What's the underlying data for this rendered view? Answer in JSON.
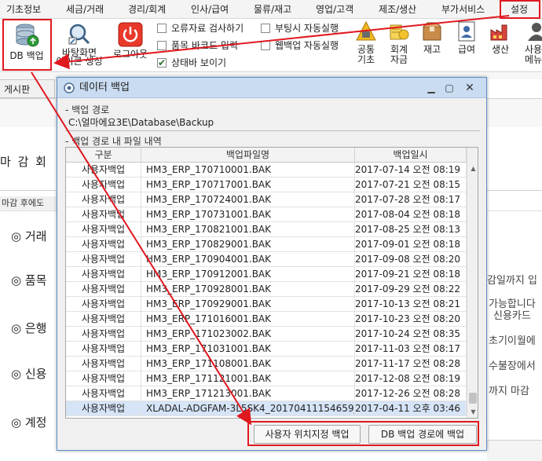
{
  "menubar": {
    "items": [
      "기초정보",
      "세금/거래",
      "경리/회계",
      "인사/급여",
      "물류/재고",
      "영업/고객",
      "제조/생산",
      "부가서비스",
      "설정"
    ]
  },
  "toolbar": {
    "db_backup": "DB 백업",
    "desktop_icon_line1": "바탕화면",
    "desktop_icon_line2": "아이콘 생성",
    "logout": "로그아웃",
    "checkbox_error_check": "오류자료 검사하기",
    "checkbox_barcode": "품목 바코드 입력",
    "checkbox_statusbar": "상태바 보이기",
    "checkbox_boot_run": "부팅시 자동실행",
    "checkbox_web_backup": "웹백업 자동실행",
    "right_buttons": [
      {
        "line1": "공통",
        "line2": "기초"
      },
      {
        "line1": "회계",
        "line2": "자금"
      },
      {
        "line1": "재고",
        "line2": ""
      },
      {
        "line1": "급여",
        "line2": ""
      },
      {
        "line1": "생산",
        "line2": ""
      },
      {
        "line1": "사용",
        "line2": "메뉴"
      }
    ]
  },
  "background": {
    "tab_board": "게시판",
    "page_title": "마 감 회",
    "after_close_label": "마감 후에도",
    "bullets": [
      "◎ 거래",
      "◎ 품목",
      "◎ 은행",
      "◎ 신용",
      "◎ 계정"
    ],
    "right_fragments": [
      "감일까지 입",
      "가능합니다",
      "신용카드",
      "초기이월에",
      "수불장에서",
      "까지 마감"
    ]
  },
  "dialog": {
    "title": "데이터 백업",
    "path_section_label": "- 백업 경로",
    "path_value": "C:\\얼마에요3E\\Database\\Backup",
    "list_section_label": "- 백업 경로 내 파일 내역",
    "columns": [
      "구분",
      "백업파일명",
      "백업일시"
    ],
    "rows": [
      {
        "type": "사용자백업",
        "file": "HM3_ERP_170710001.BAK",
        "date": "2017-07-14 오전 08:19"
      },
      {
        "type": "사용자백업",
        "file": "HM3_ERP_170717001.BAK",
        "date": "2017-07-21 오전 08:15"
      },
      {
        "type": "사용자백업",
        "file": "HM3_ERP_170724001.BAK",
        "date": "2017-07-28 오전 08:17"
      },
      {
        "type": "사용자백업",
        "file": "HM3_ERP_170731001.BAK",
        "date": "2017-08-04 오전 08:18"
      },
      {
        "type": "사용자백업",
        "file": "HM3_ERP_170821001.BAK",
        "date": "2017-08-25 오전 08:13"
      },
      {
        "type": "사용자백업",
        "file": "HM3_ERP_170829001.BAK",
        "date": "2017-09-01 오전 08:18"
      },
      {
        "type": "사용자백업",
        "file": "HM3_ERP_170904001.BAK",
        "date": "2017-09-08 오전 08:20"
      },
      {
        "type": "사용자백업",
        "file": "HM3_ERP_170912001.BAK",
        "date": "2017-09-21 오전 08:18"
      },
      {
        "type": "사용자백업",
        "file": "HM3_ERP_170928001.BAK",
        "date": "2017-09-29 오전 08:22"
      },
      {
        "type": "사용자백업",
        "file": "HM3_ERP_170929001.BAK",
        "date": "2017-10-13 오전 08:21"
      },
      {
        "type": "사용자백업",
        "file": "HM3_ERP_171016001.BAK",
        "date": "2017-10-23 오전 08:20"
      },
      {
        "type": "사용자백업",
        "file": "HM3_ERP_171023002.BAK",
        "date": "2017-10-24 오전 08:35"
      },
      {
        "type": "사용자백업",
        "file": "HM3_ERP_171031001.BAK",
        "date": "2017-11-03 오전 08:17"
      },
      {
        "type": "사용자백업",
        "file": "HM3_ERP_171108001.BAK",
        "date": "2017-11-17 오전 08:28"
      },
      {
        "type": "사용자백업",
        "file": "HM3_ERP_171121001.BAK",
        "date": "2017-12-08 오전 08:19"
      },
      {
        "type": "사용자백업",
        "file": "HM3_ERP_171213001.BAK",
        "date": "2017-12-26 오전 08:28"
      },
      {
        "type": "사용자백업",
        "file": "XLADAL-ADGFAM-3L5SK4_20170411154659_...",
        "date": "2017-04-11 오후 03:46"
      }
    ],
    "button_user_location": "사용자 위치지정 백업",
    "button_db_path": "DB 백업 경로에 백업"
  },
  "colors": {
    "annotation_red": "#e0181f",
    "titlebar": "#c9dcf1",
    "selected_row": "#d6e4f7"
  }
}
